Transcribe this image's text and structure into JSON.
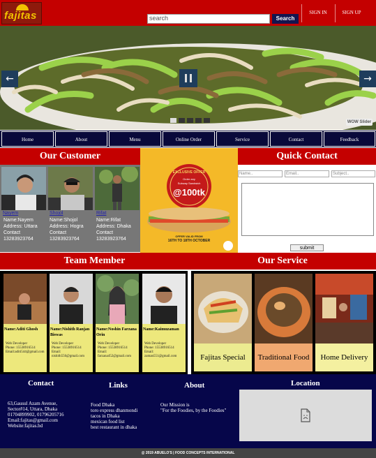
{
  "header": {
    "logo_text": "fajitas",
    "search_placeholder": "search",
    "search_button": "Search",
    "signin": "SIGN IN",
    "signup": "SIGN UP"
  },
  "slider": {
    "watermark": "WOW Slider",
    "prev_icon": "arrow-left-icon",
    "next_icon": "arrow-right-icon",
    "pause_icon": "pause-icon"
  },
  "nav": [
    "Home",
    "About",
    "Menu",
    "Online Order",
    "Service",
    "Contact",
    "Feedback"
  ],
  "customers": {
    "title": "Our Customer",
    "items": [
      {
        "link": "Nayem",
        "name": "Name:Nayem",
        "address": "Address: Uttara",
        "contact": "Contact",
        "phone": "13283923764"
      },
      {
        "link": "Shojol",
        "name": "Name:Shojol",
        "address": "Address: Hogra",
        "contact": "Contact",
        "phone": "13283923764"
      },
      {
        "link": "Rifat",
        "name": "Name:Rifat",
        "address": "Address: Dhaka",
        "contact": "Contact",
        "phone": "13283923764"
      }
    ]
  },
  "promo": {
    "line1": "EXCLUSIVE OFFER",
    "line2": "Order any",
    "line3": "Subway Sandwich",
    "price": "@100tk",
    "offer_line": "OFFER VALID FROM",
    "dates": "16TH TO 18TH OCTOBER"
  },
  "quick_contact": {
    "title": "Quick Contact",
    "name_placeholder": "Name..",
    "email_placeholder": "Email..",
    "subject_placeholder": "Subject..",
    "submit": "submit"
  },
  "team": {
    "title": "Team Member",
    "members": [
      {
        "name": "Name:Aditi Ghosh",
        "role": "Web Developer",
        "phone": "Phone: 15538916514",
        "email": "Email:aditi544@gmail.com"
      },
      {
        "name": "Name:Nishith Ranjan Biswas",
        "role": "Web Developer",
        "phone": "Phone: 15538916514",
        "email": "Email: nishith556@gmail.com"
      },
      {
        "name": "Name:Noshin Farzana Orin",
        "role": "Web Developer",
        "phone": "Phone: 15538916514",
        "email": "Email: farzana452@gmail.com"
      },
      {
        "name": "Name:Kaimuzaman",
        "role": "Web Developer",
        "phone": "Phone: 15538916514",
        "email": "Email: zaman551@gmail.com"
      }
    ]
  },
  "service": {
    "title": "Our Service",
    "items": [
      "Fajitas Special",
      "Traditional Food",
      "Home Delivery"
    ]
  },
  "footer": {
    "contact_title": "Contact",
    "contact_lines": [
      "63,Gausul Azam Avenue,",
      "Sector#14, Uttara, Dhaka",
      "01704899902, 01796205716",
      "Email:fajitas@gmail.com",
      "Website:fajitas.bd"
    ],
    "links_title": "Links",
    "links": [
      "Food Dhaka",
      "toro express dhanmondi",
      "tacos in Dhaka",
      "mexican food list",
      "best restaurant in dhaka"
    ],
    "about_title": "About",
    "about_lines": [
      "Our Mission is",
      "\"For the Foodies, by the Foodies\""
    ],
    "location_title": "Location",
    "copyright": "@ 2019 ABUELO'S | FOOD CONCEPTS INTERNATIONAL"
  },
  "colors": {
    "brand_red": "#c40000",
    "navy": "#06064a",
    "card_yellow": "#ede87c"
  }
}
